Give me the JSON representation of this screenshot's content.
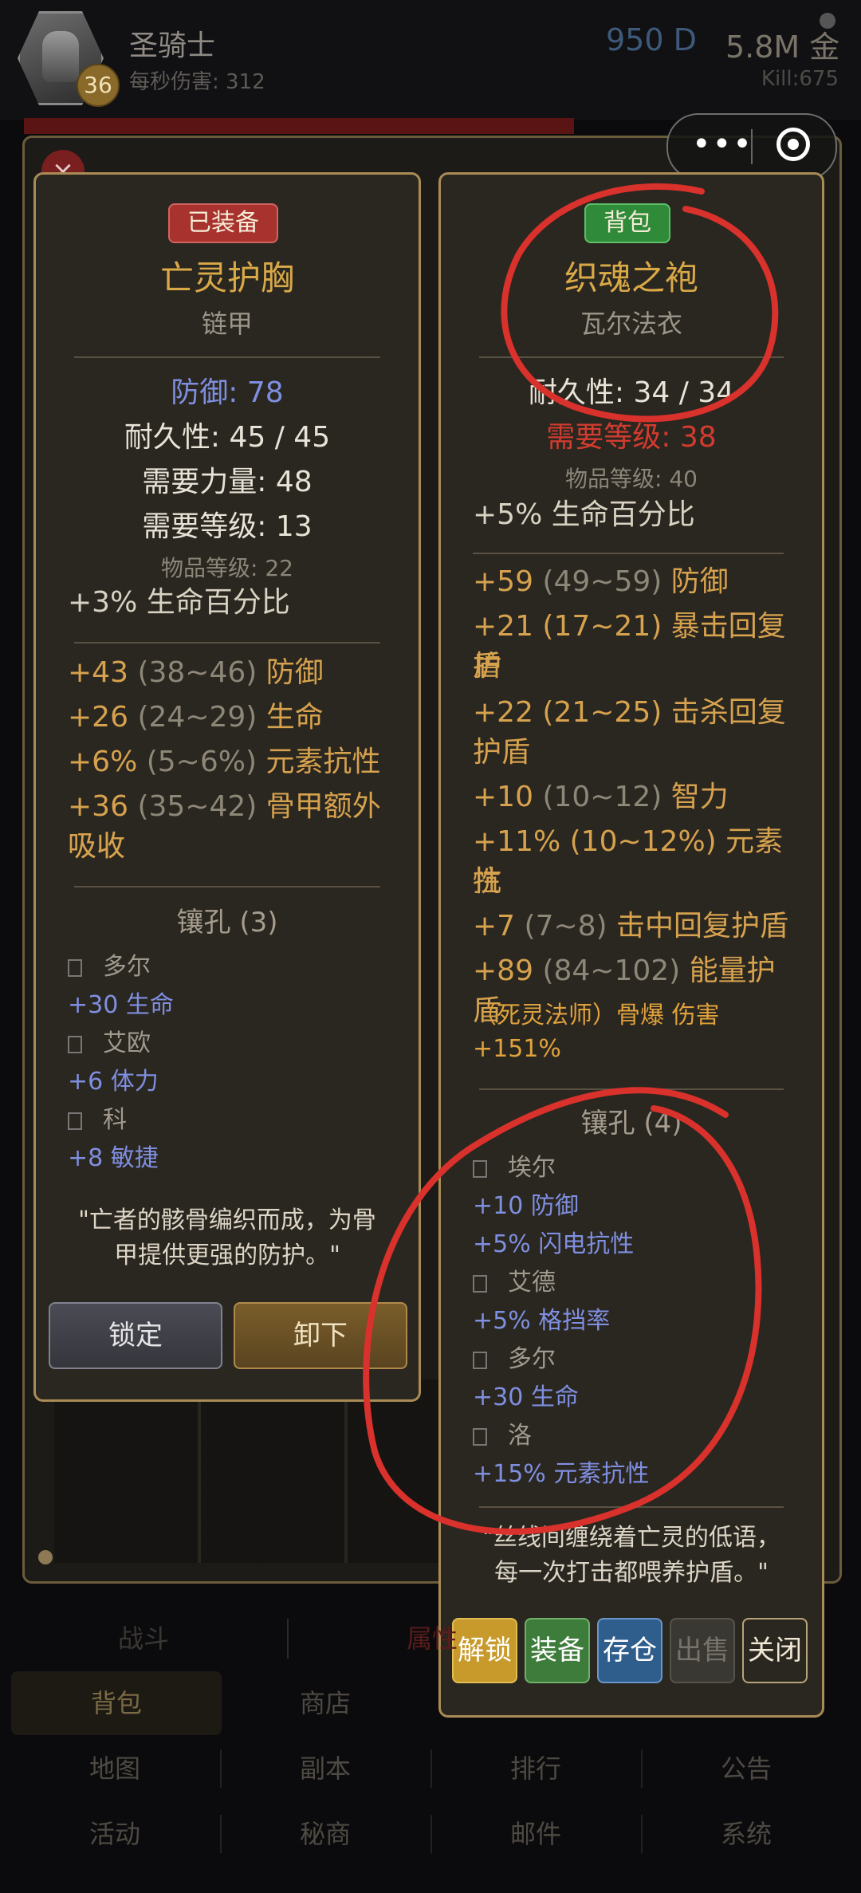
{
  "header": {
    "char_name": "圣骑士",
    "level": "36",
    "dps_line": "每秒伤害: 312",
    "gems": "950 D",
    "gold": "5.8M 金",
    "kills": "Kill:675"
  },
  "background": {
    "close_glyph": "×",
    "title_fragment": "背"
  },
  "capsule": {
    "more_icon": "more-dots-icon",
    "close_icon": "target-icon"
  },
  "equipped_item": {
    "tag": "已装备",
    "name": "亡灵护胸",
    "type": "链甲",
    "defense": "防御: 78",
    "durability": "耐久性: 45 / 45",
    "req_str": "需要力量: 48",
    "req_level": "需要等级: 13",
    "item_level": "物品等级: 22",
    "implicit": "+3% 生命百分比",
    "affixes": [
      {
        "value": "+43",
        "range": "(38~46)",
        "stat": "防御"
      },
      {
        "value": "+26",
        "range": "(24~29)",
        "stat": "生命"
      },
      {
        "value": "+6%",
        "range": "(5~6%)",
        "stat": "元素抗性"
      },
      {
        "value": "+36",
        "range": "(35~42)",
        "stat": "骨甲额外吸收"
      }
    ],
    "socket_title": "镶孔 (3)",
    "runes": [
      {
        "name": "多尔",
        "bonus": "+30 生命"
      },
      {
        "name": "艾欧",
        "bonus": "+6 体力"
      },
      {
        "name": "科",
        "bonus": "+8 敏捷"
      }
    ],
    "flavor_1": "\"亡者的骸骨编织而成，为骨",
    "flavor_2": "甲提供更强的防护。\"",
    "btn_lock": "锁定",
    "btn_unequip": "卸下"
  },
  "bag_item": {
    "tag": "背包",
    "name": "织魂之袍",
    "type": "瓦尔法衣",
    "durability": "耐久性: 34 / 34",
    "req_level": "需要等级: 38",
    "item_level": "物品等级: 40",
    "implicit": "+5% 生命百分比",
    "affixes": [
      {
        "value": "+59",
        "range": "(49~59)",
        "stat": "防御"
      },
      {
        "value": "+21 (17~21) 暴击回复护",
        "range": "",
        "stat": ""
      },
      {
        "value": "盾",
        "range": "",
        "stat": ""
      },
      {
        "value": "+22 (21~25) 击杀回复",
        "range": "",
        "stat": ""
      },
      {
        "value": "护盾",
        "range": "",
        "stat": ""
      },
      {
        "value": "+10",
        "range": "(10~12)",
        "stat": "智力"
      },
      {
        "value": "+11% (10~12%) 元素抗",
        "range": "",
        "stat": ""
      },
      {
        "value": "性",
        "range": "",
        "stat": ""
      },
      {
        "value": "+7",
        "range": "(7~8)",
        "stat": "击中回复护盾"
      },
      {
        "value": "+89",
        "range": "(84~102)",
        "stat": "能量护盾"
      }
    ],
    "skill_line_1": "（死灵法师）骨爆 伤害",
    "skill_line_2": "+151%",
    "socket_title": "镶孔 (4)",
    "runes": [
      {
        "name": "埃尔",
        "bonus": "+10 防御"
      },
      {
        "name": "",
        "bonus": "+5% 闪电抗性"
      },
      {
        "name": "艾德",
        "bonus": "+5% 格挡率"
      },
      {
        "name": "多尔",
        "bonus": "+30 生命"
      },
      {
        "name": "洛",
        "bonus": "+15% 元素抗性"
      }
    ],
    "flavor_1": "\"丝线间缠绕着亡灵的低语，",
    "flavor_2": "每一次打击都喂养护盾。\"",
    "btn_unlock": "解锁",
    "btn_equip": "装备",
    "btn_store": "存仓",
    "btn_sell": "出售",
    "btn_close": "关闭"
  },
  "tabs": {
    "battle": "战斗",
    "attr": "属性"
  },
  "nav": {
    "row1": [
      "背包",
      "商店",
      "",
      ""
    ],
    "row2": [
      "地图",
      "副本",
      "排行",
      "公告"
    ],
    "row3": [
      "活动",
      "秘商",
      "邮件",
      "系统"
    ]
  },
  "colors": {
    "accent_gold": "#d9a947",
    "rune_blue": "#7f8fe0",
    "equipped_tag": "#a8322e",
    "bag_tag": "#2f8a3a",
    "annotation_red": "#d9312b"
  }
}
